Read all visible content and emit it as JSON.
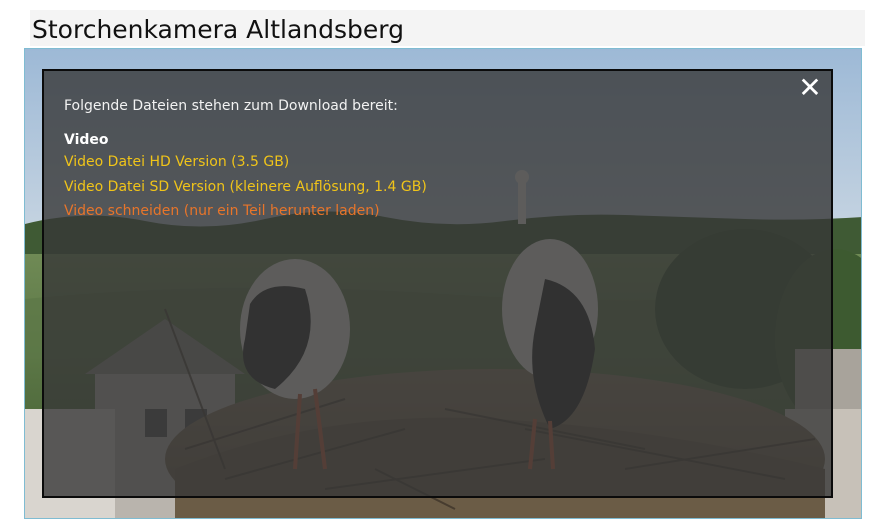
{
  "page": {
    "title": "Storchenkamera Altlandsberg"
  },
  "download_dialog": {
    "intro": "Folgende Dateien stehen zum Download bereit:",
    "section_title": "Video",
    "close_icon": "close-icon",
    "links": {
      "hd": "Video Datei HD Version (3.5 GB)",
      "sd": "Video Datei SD Version (kleinere Auflösung, 1.4 GB)",
      "cut": "Video schneiden (nur ein Teil herunter laden)"
    }
  },
  "colors": {
    "link": "#f0c419",
    "link_cut": "#e8752a",
    "player_border": "#7fbcd2"
  }
}
